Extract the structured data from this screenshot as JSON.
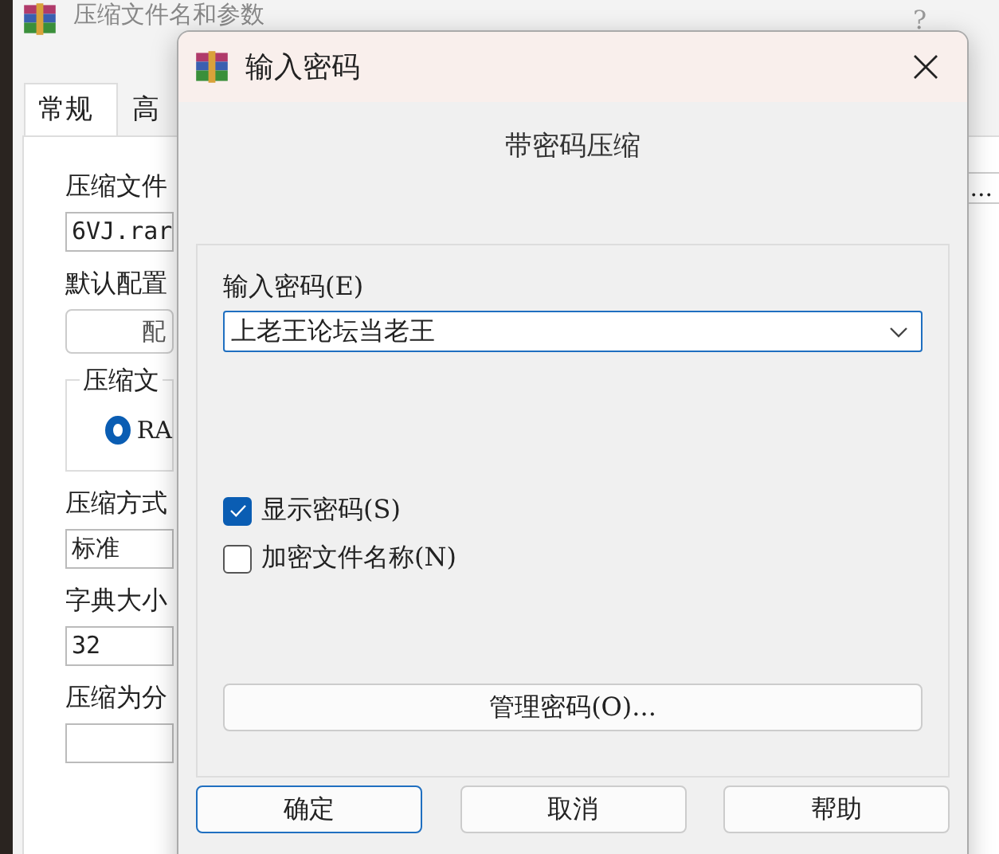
{
  "background_window": {
    "title": "压缩文件名和参数",
    "help": "?",
    "tabs": [
      {
        "label": "常规",
        "selected": true
      },
      {
        "label": "高",
        "selected": false
      }
    ],
    "archive_name": {
      "label": "压缩文件",
      "value": "6VJ.rar"
    },
    "browse_button": "...",
    "default_profile": {
      "label": "默认配置",
      "button": "配"
    },
    "format_group": {
      "label": "压缩文",
      "options": [
        {
          "label": "RA",
          "selected": true
        }
      ]
    },
    "method": {
      "label": "压缩方式",
      "value": "标准"
    },
    "dictionary": {
      "label": "字典大小",
      "value": "32"
    },
    "split": {
      "label": "压缩为分"
    }
  },
  "dialog": {
    "title": "输入密码",
    "heading": "带密码压缩",
    "password": {
      "label": "输入密码(E)",
      "value": "上老王论坛当老王"
    },
    "checkboxes": [
      {
        "label": "显示密码(S)",
        "checked": true
      },
      {
        "label": "加密文件名称(N)",
        "checked": false
      }
    ],
    "manage_button": "管理密码(O)...",
    "buttons": [
      {
        "label": "确定",
        "default": true
      },
      {
        "label": "取消",
        "default": false
      },
      {
        "label": "帮助",
        "default": false
      }
    ]
  }
}
